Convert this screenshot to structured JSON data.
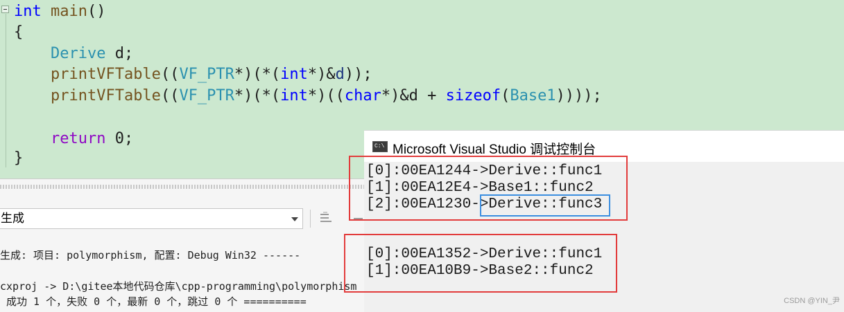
{
  "editor": {
    "lines": {
      "l1": {
        "kw": "int",
        "fn": "main",
        "rest": "()"
      },
      "l2": "{",
      "l3": {
        "type": "Derive",
        "rest": " d;"
      },
      "l4": {
        "fn": "printVFTable",
        "p1": "((",
        "type": "VF_PTR",
        "p2": "*)(*(",
        "kw": "int",
        "p3": "*)&",
        "var": "d",
        "p4": "));"
      },
      "l5": {
        "fn": "printVFTable",
        "p1": "((",
        "type": "VF_PTR",
        "p2": "*)(*(",
        "kw": "int",
        "p3": "*)((",
        "kw2": "char",
        "p4": "*)&d + ",
        "kw3": "sizeof",
        "p5": "(",
        "type2": "Base1",
        "p6": "))));"
      },
      "l7": {
        "ctrl": "return",
        "rest": " 0;"
      },
      "l8": "}"
    }
  },
  "output_panel": {
    "source_label": "生成",
    "lines": [
      "生成: 项目: polymorphism, 配置: Debug Win32 ------",
      "cxproj -> D:\\gitee本地代码仓库\\cpp-programming\\polymorphism",
      " 成功 1 个，失败 0 个，最新 0 个，跳过 0 个 =========="
    ]
  },
  "console": {
    "title": "Microsoft Visual Studio 调试控制台",
    "icon_text": "C:\\",
    "group1": [
      "[0]:00EA1244->Derive::func1",
      "[1]:00EA12E4->Base1::func2",
      "[2]:00EA1230->Derive::func3"
    ],
    "group2": [
      "[0]:00EA1352->Derive::func1",
      "[1]:00EA10B9->Base2::func2"
    ]
  },
  "watermark": "CSDN @YIN_尹",
  "colors": {
    "annotation_red": "#e23b3b",
    "annotation_blue": "#3b8ee0",
    "editor_bg": "#cce8cf"
  }
}
